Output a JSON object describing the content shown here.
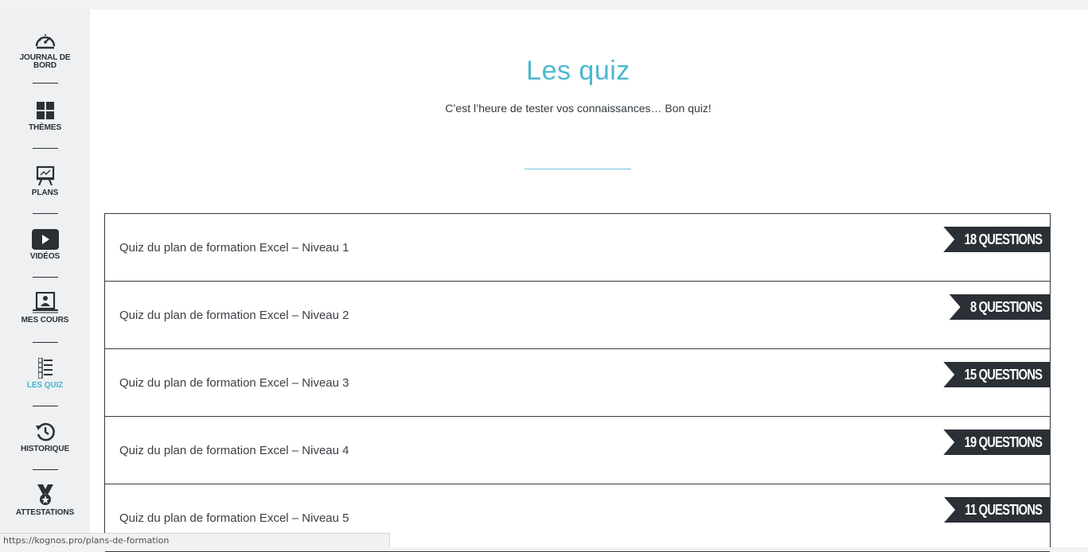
{
  "sidebar": {
    "items": [
      {
        "label": "JOURNAL DE BORD",
        "icon": "dashboard-gauge-icon",
        "active": false
      },
      {
        "label": "THÈMES",
        "icon": "grid-icon",
        "active": false
      },
      {
        "label": "PLANS",
        "icon": "presentation-board-icon",
        "active": false
      },
      {
        "label": "VIDÉOS",
        "icon": "play-video-icon",
        "active": false
      },
      {
        "label": "MES COURS",
        "icon": "user-screen-icon",
        "active": false
      },
      {
        "label": "LES QUIZ",
        "icon": "list-icon",
        "active": true
      },
      {
        "label": "HISTORIQUE",
        "icon": "history-clock-icon",
        "active": false
      },
      {
        "label": "ATTESTATIONS",
        "icon": "medal-icon",
        "active": false
      }
    ],
    "active_color": "#3fb7d3"
  },
  "main": {
    "title": "Les quiz",
    "subtitle": "C’est l’heure de tester vos connaissances… Bon quiz!",
    "quizzes": [
      {
        "name": "Quiz du plan de formation Excel – Niveau 1",
        "badge": "18 QUESTIONS"
      },
      {
        "name": "Quiz du plan de formation Excel – Niveau 2",
        "badge": "8 QUESTIONS"
      },
      {
        "name": "Quiz du plan de formation Excel – Niveau 3",
        "badge": "15 QUESTIONS"
      },
      {
        "name": "Quiz du plan de formation Excel – Niveau 4",
        "badge": "19 QUESTIONS"
      },
      {
        "name": "Quiz du plan de formation Excel – Niveau 5",
        "badge": "11 QUESTIONS"
      }
    ]
  },
  "statusbar": {
    "url": "https://kognos.pro/plans-de-formation"
  }
}
